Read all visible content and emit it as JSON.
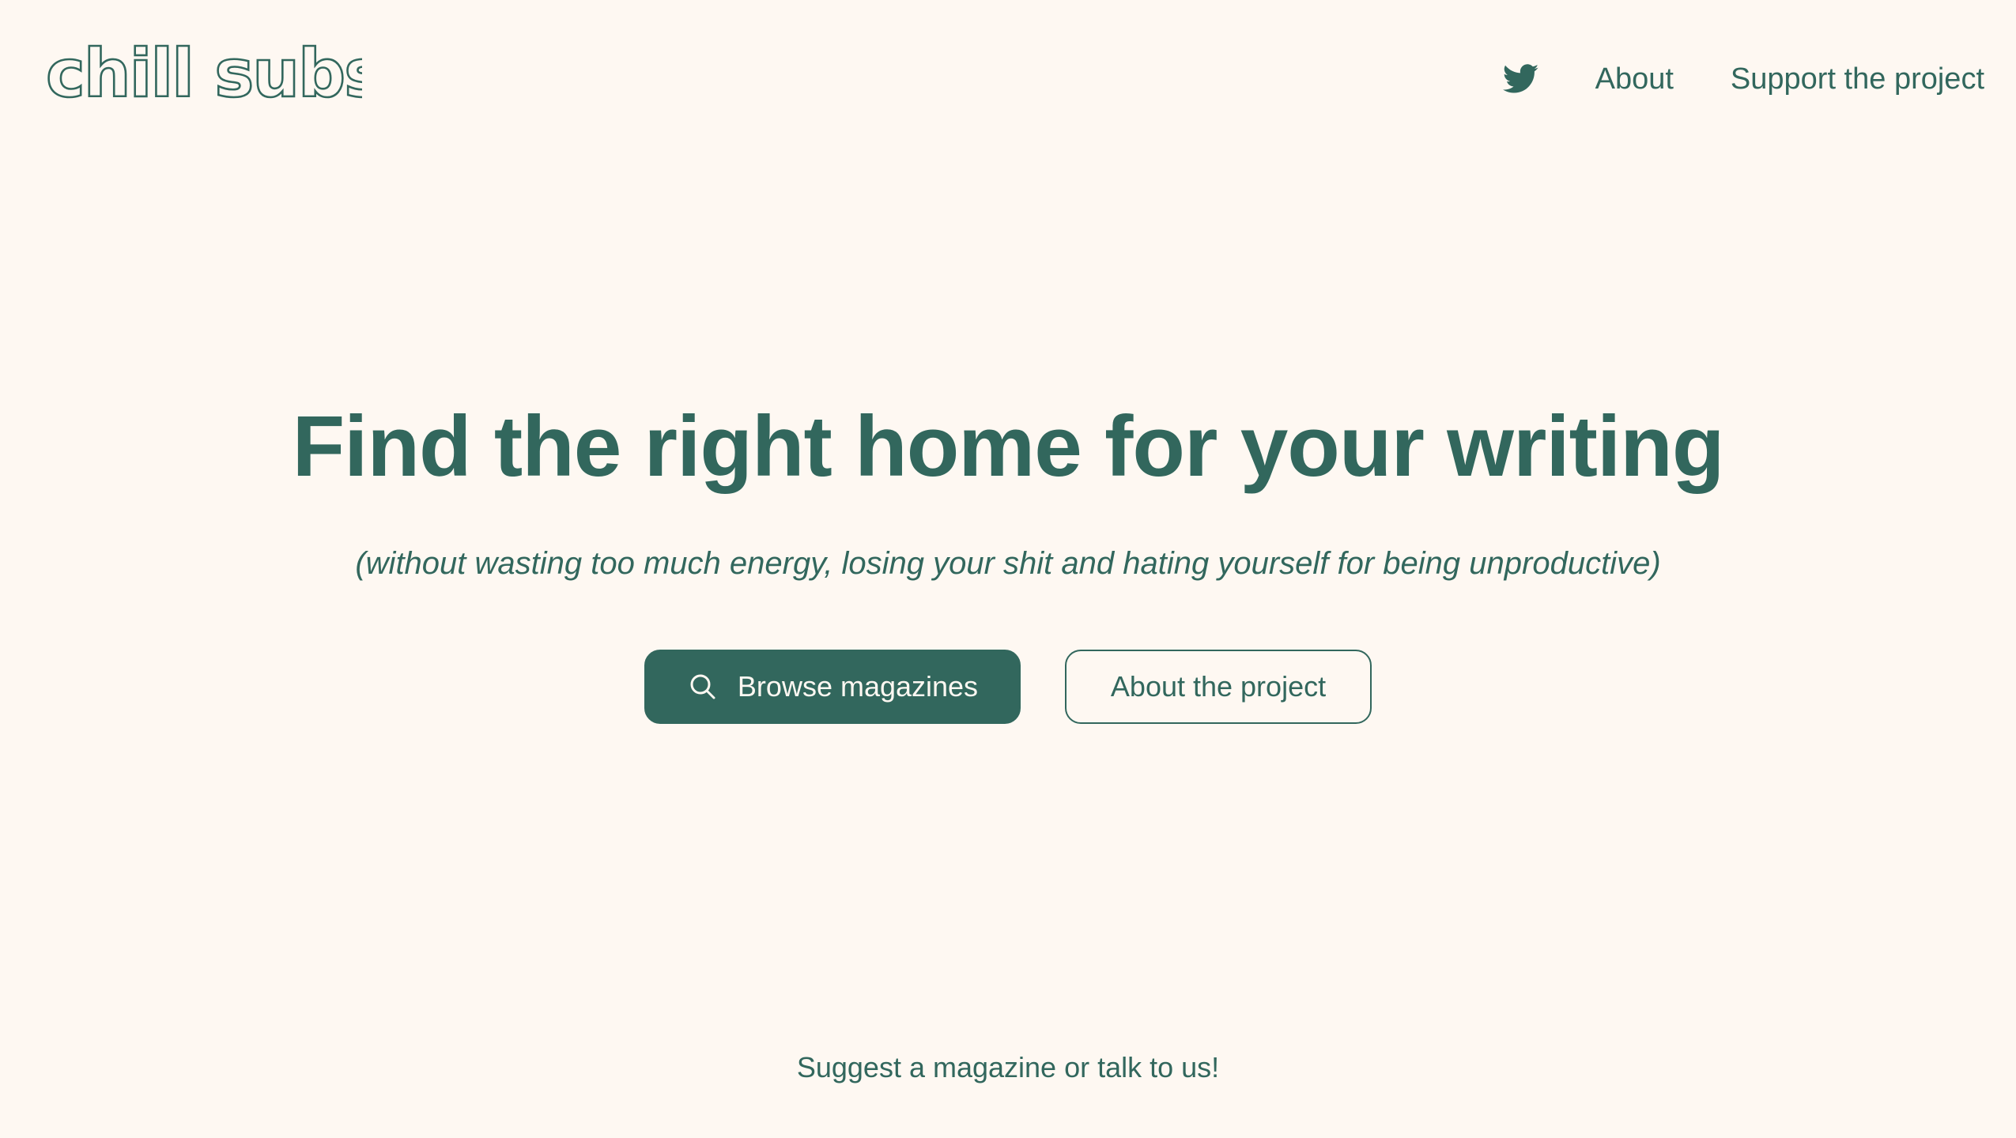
{
  "header": {
    "logo_text": "chill subs",
    "nav": {
      "twitter_icon": "twitter-bird-icon",
      "about_label": "About",
      "support_label": "Support the project"
    }
  },
  "hero": {
    "title": "Find the right home for your writing",
    "subtitle": "(without wasting too much energy, losing your shit and hating yourself for being unproductive)",
    "primary_button": {
      "label": "Browse magazines",
      "icon": "search-icon"
    },
    "secondary_button": {
      "label": "About the project"
    }
  },
  "footer": {
    "link_label": "Suggest a magazine or talk to us!"
  },
  "colors": {
    "background": "#fef8f2",
    "brand": "#32675d"
  }
}
